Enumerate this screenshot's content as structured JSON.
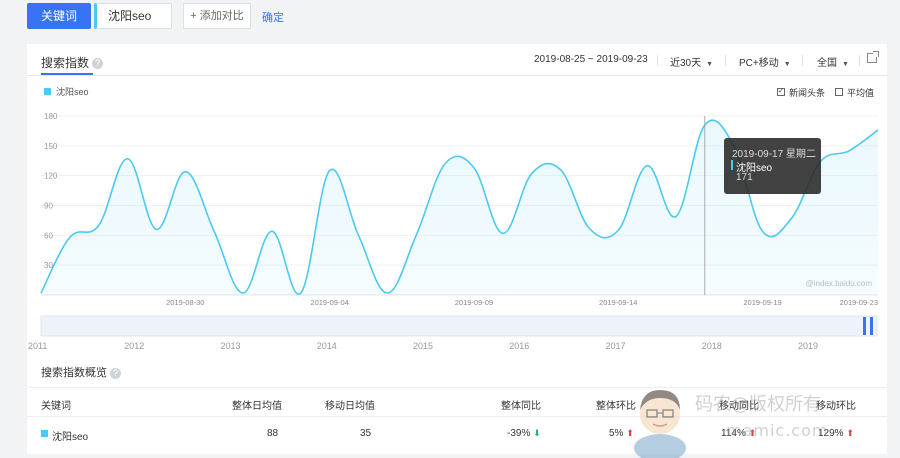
{
  "toolbar": {
    "keyword_button": "关键词",
    "keyword_value": "沈阳seo",
    "add_compare": "+ 添加对比",
    "confirm": "确定"
  },
  "panel": {
    "tab_title": "搜索指数",
    "date_range": "2019-08-25 ~ 2019-09-23",
    "period": "近30天",
    "device": "PC+移动",
    "region": "全国"
  },
  "legend": {
    "series": "沈阳seo",
    "news": "新闻头条",
    "average": "平均值"
  },
  "tooltip": {
    "date": "2019-09-17 星期二",
    "series": "沈阳seo",
    "value": "171"
  },
  "chart_data": {
    "type": "line",
    "y_ticks": [
      "180",
      "150",
      "120",
      "90",
      "60",
      "30"
    ],
    "ylim": [
      0,
      180
    ],
    "x_tick_labels": [
      "2019-08-30",
      "2019-09-04",
      "2019-09-09",
      "2019-09-14",
      "2019-09-19",
      "2019-09-23"
    ],
    "x": [
      "2019-08-25",
      "2019-08-26",
      "2019-08-27",
      "2019-08-28",
      "2019-08-29",
      "2019-08-30",
      "2019-08-31",
      "2019-09-01",
      "2019-09-02",
      "2019-09-03",
      "2019-09-04",
      "2019-09-05",
      "2019-09-06",
      "2019-09-07",
      "2019-09-08",
      "2019-09-09",
      "2019-09-10",
      "2019-09-11",
      "2019-09-12",
      "2019-09-13",
      "2019-09-14",
      "2019-09-15",
      "2019-09-16",
      "2019-09-17",
      "2019-09-18",
      "2019-09-19",
      "2019-09-20",
      "2019-09-21",
      "2019-09-22",
      "2019-09-23"
    ],
    "series": [
      {
        "name": "沈阳seo",
        "color": "#4cc9f0",
        "values": [
          2,
          58,
          70,
          137,
          66,
          124,
          64,
          2,
          64,
          2,
          125,
          60,
          2,
          60,
          132,
          128,
          62,
          122,
          126,
          67,
          65,
          130,
          79,
          171,
          150,
          64,
          77,
          134,
          145,
          166
        ]
      }
    ],
    "watermark": "@index.baidu.com",
    "timeline_years": [
      "2011",
      "2012",
      "2013",
      "2014",
      "2015",
      "2016",
      "2017",
      "2018",
      "2019"
    ]
  },
  "overview": {
    "title": "搜索指数概览",
    "headers": [
      "关键词",
      "整体日均值",
      "移动日均值",
      "整体同比",
      "整体环比",
      "移动同比",
      "移动环比"
    ],
    "row": {
      "keyword": "沈阳seo",
      "overall_avg": "88",
      "mobile_avg": "35",
      "overall_yoy": "-39%",
      "overall_mom": "5%",
      "mobile_yoy": "114%",
      "mobile_mom": "129%"
    }
  },
  "watermark": {
    "text_cn": "码农@版权所有",
    "text_url": "mamic.com"
  }
}
